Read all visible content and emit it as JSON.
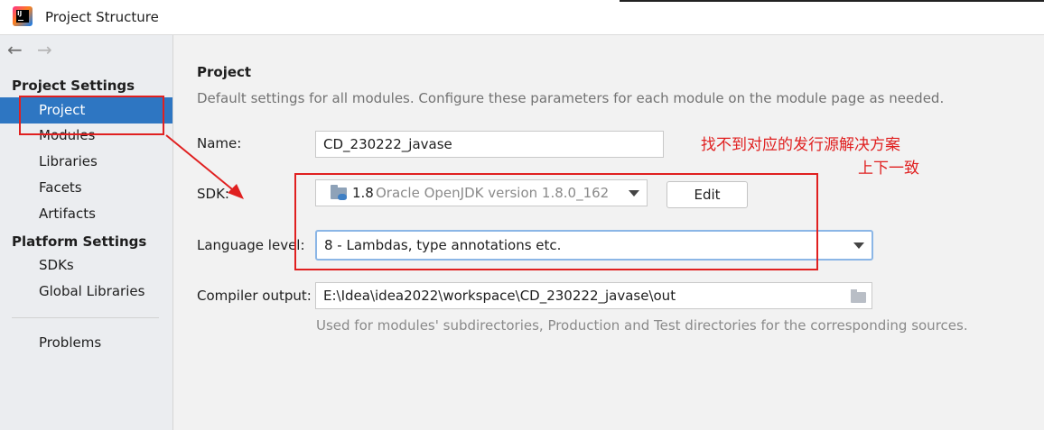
{
  "window": {
    "title": "Project Structure"
  },
  "nav": {
    "back_glyph": "←",
    "forward_glyph": "→"
  },
  "sidebar": {
    "project_settings_title": "Project Settings",
    "project_settings_items": [
      {
        "label": "Project",
        "selected": true
      },
      {
        "label": "Modules"
      },
      {
        "label": "Libraries"
      },
      {
        "label": "Facets"
      },
      {
        "label": "Artifacts"
      }
    ],
    "platform_settings_title": "Platform Settings",
    "platform_settings_items": [
      {
        "label": "SDKs"
      },
      {
        "label": "Global Libraries"
      }
    ],
    "other_items": [
      {
        "label": "Problems"
      }
    ]
  },
  "main": {
    "heading": "Project",
    "description": "Default settings for all modules. Configure these parameters for each module on the module page as needed.",
    "name_label": "Name:",
    "name_value": "CD_230222_javase",
    "sdk_label": "SDK:",
    "sdk_version": "1.8",
    "sdk_name": "Oracle OpenJDK version 1.8.0_162",
    "edit_button": "Edit",
    "language_level_label": "Language level:",
    "language_level_value": "8 - Lambdas, type annotations etc.",
    "compiler_output_label": "Compiler output:",
    "compiler_output_value": "E:\\Idea\\idea2022\\workspace\\CD_230222_javase\\out",
    "compiler_output_hint": "Used for modules' subdirectories, Production and Test directories for the corresponding sources."
  },
  "annotation": {
    "line1": "找不到对应的发行源解决方案",
    "line2": "上下一致",
    "color": "#e02020"
  },
  "colors": {
    "selection": "#2e76c2",
    "focus_border": "#8bb6e6"
  },
  "icons": [
    "app-logo-icon",
    "back-arrow-icon",
    "forward-arrow-icon",
    "sdk-folder-icon",
    "dropdown-arrow-icon",
    "browse-folder-icon"
  ]
}
